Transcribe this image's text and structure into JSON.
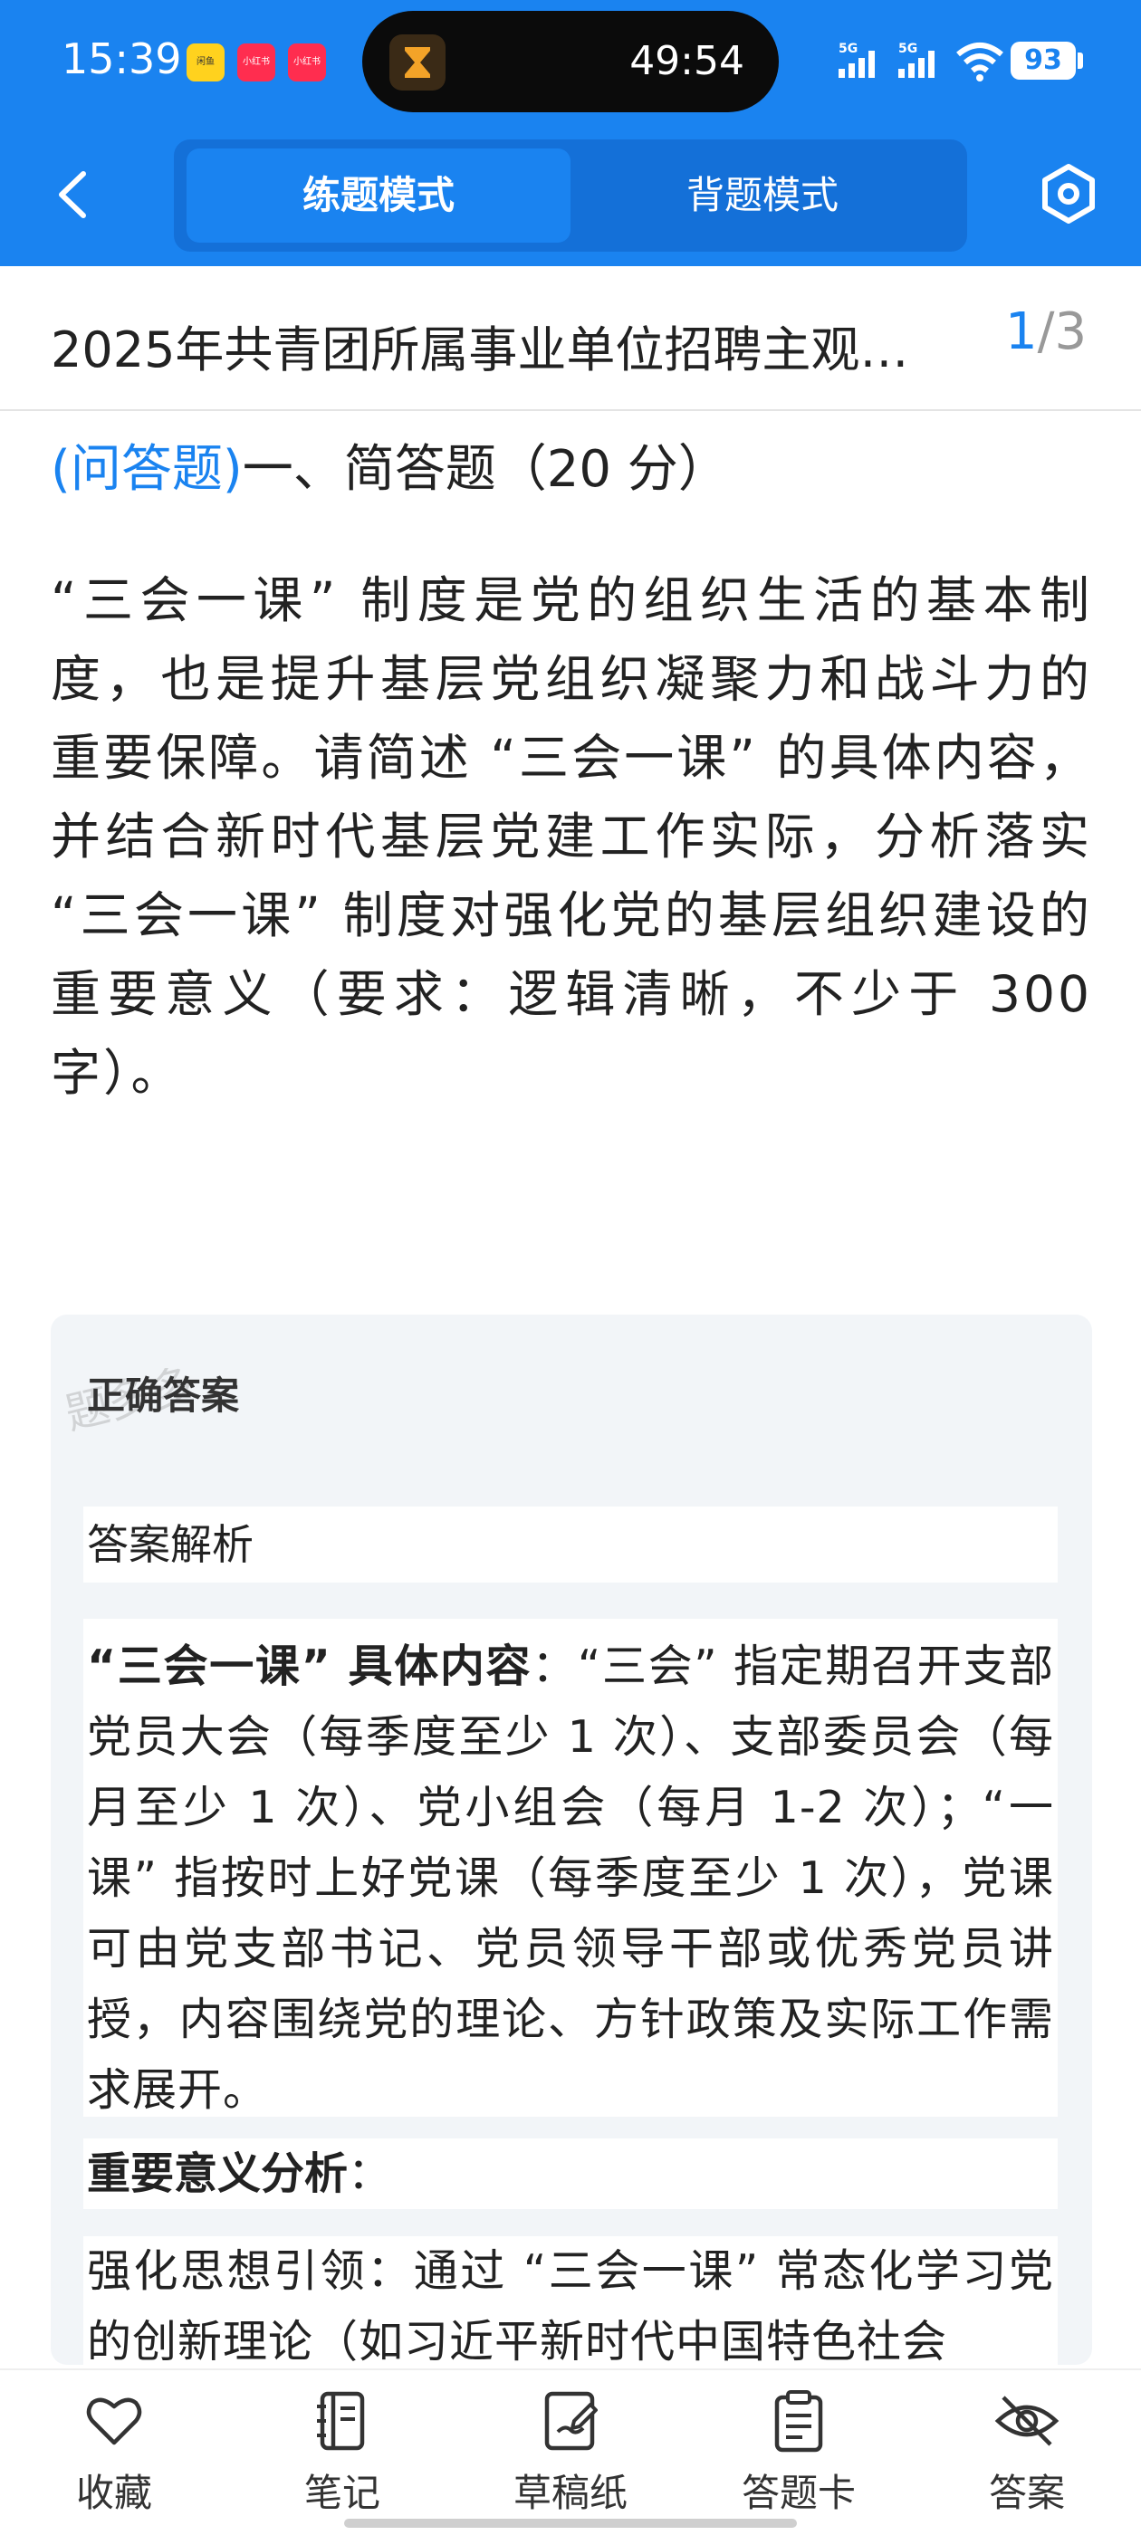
{
  "status_bar": {
    "time": "15:39",
    "notifications": [
      "闲鱼",
      "小红书",
      "小红书"
    ],
    "timer": "49:54",
    "signal1": "5G",
    "signal2": "5G",
    "battery": "93"
  },
  "nav": {
    "tabs": [
      {
        "label": "练题模式",
        "active": true
      },
      {
        "label": "背题模式",
        "active": false
      }
    ]
  },
  "exam": {
    "title": "2025年共青团所属事业单位招聘主观…",
    "current": "1",
    "separator": "/",
    "total": "3"
  },
  "question": {
    "type": "(问答题)",
    "heading": "一、简答题（20 分）",
    "body": "“三会一课” 制度是党的组织生活的基本制度，也是提升基层党组织凝聚力和战斗力的重要保障。请简述 “三会一课” 的具体内容，并结合新时代基层党建工作实际，分析落实 “三会一课” 制度对强化党的基层组织建设的重要意义（要求：逻辑清晰，不少于 300 字）。"
  },
  "answer": {
    "watermark": "题多多",
    "correct_label": "正确答案",
    "analysis_label": "答案解析",
    "content_title": "“三会一课” 具体内容",
    "content_text": "：“三会” 指定期召开支部党员大会（每季度至少 1 次）、支部委员会（每月至少 1 次）、党小组会（每月 1-2 次）；“一课” 指按时上好党课（每季度至少 1 次），党课可由党支部书记、党员领导干部或优秀党员讲授，内容围绕党的理论、方针政策及实际工作需求展开。",
    "significance_title": "重要意义分析",
    "significance_colon": "：",
    "lead_text": "强化思想引领：通过 “三会一课” 常态化学习党的创新理论（如习近平新时代中国特色社会"
  },
  "bottom_tabs": [
    {
      "label": "收藏",
      "icon": "heart-icon"
    },
    {
      "label": "笔记",
      "icon": "notebook-icon"
    },
    {
      "label": "草稿纸",
      "icon": "draft-icon"
    },
    {
      "label": "答题卡",
      "icon": "clipboard-icon"
    },
    {
      "label": "答案",
      "icon": "eye-off-icon"
    }
  ],
  "colors": {
    "primary": "#1a83f0",
    "answer_bg": "#f2f5f8"
  }
}
